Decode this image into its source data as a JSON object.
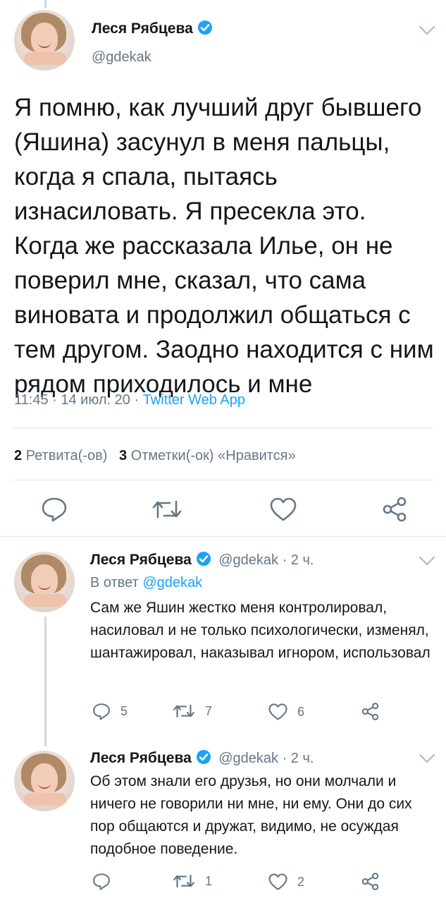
{
  "main_tweet": {
    "author_name": "Леся Рябцева",
    "handle": "@gdekak",
    "text": "Я помню, как лучший друг бывшего (Яшина) засунул в меня пальцы, когда я спала, пытаясь изнасиловать. Я пресекла это. Когда же рассказала Илье, он не поверил мне, сказал, что сама виновата и продолжил общаться с тем другом. Заодно находится с ним рядом приходилось и мне",
    "time": "11:45 · 14 июл. 20 · ",
    "source": "Twitter Web App",
    "retweets_count": "2",
    "retweets_label": "Ретвита(-ов)",
    "likes_count": "3",
    "likes_label": "Отметки(-ок) «Нравится»"
  },
  "replies": [
    {
      "author_name": "Леся Рябцева",
      "meta": "@gdekak · 2 ч.",
      "reply_prefix": "В ответ ",
      "reply_handle": "@gdekak",
      "text": "Сам же Яшин жестко меня контролировал, насиловал и не только психологически, изменял, шантажировал, наказывал игнором, использовал",
      "reply_count": "5",
      "retweet_count": "7",
      "like_count": "6"
    },
    {
      "author_name": "Леся Рябцева",
      "meta": "@gdekak · 2 ч.",
      "text": "Об этом знали его друзья, но они молчали и ничего не говорили ни мне, ни ему. Они до сих пор общаются и дружат, видимо, не осуждая подобное поведение.",
      "reply_count": "",
      "retweet_count": "1",
      "like_count": "2"
    }
  ],
  "colors": {
    "accent": "#1da1f2",
    "muted": "#657786",
    "text": "#14171a",
    "divider": "#e1e8ed"
  },
  "icons": [
    "verified-badge-icon",
    "chevron-down-icon",
    "reply-icon",
    "retweet-icon",
    "like-icon",
    "share-icon"
  ]
}
